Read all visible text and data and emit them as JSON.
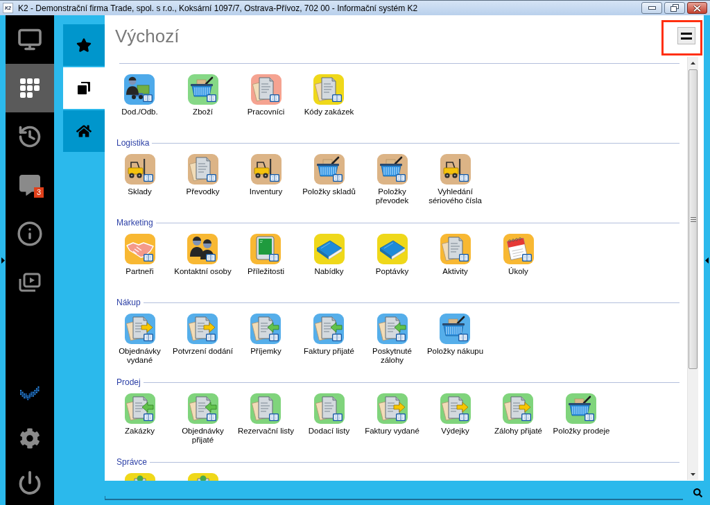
{
  "window": {
    "app_icon_text": "K2",
    "title": "K2 - Demonstrační firma Trade, spol. s r.o., Koksární 1097/7, Ostrava-Přívoz, 702 00 - Informační systém K2"
  },
  "sidebar": {
    "items": [
      {
        "selected": false
      },
      {
        "selected": true
      },
      {
        "selected": false
      },
      {
        "selected": false,
        "badge": "3"
      },
      {
        "selected": false
      },
      {
        "selected": false
      }
    ]
  },
  "tabs": [
    {
      "selected": false
    },
    {
      "selected": true
    },
    {
      "selected": false
    }
  ],
  "page": {
    "title": "Výchozí",
    "menu_highlighted": true
  },
  "sections": [
    {
      "items": [
        {
          "label": "Dod./Odb.",
          "kind": "person-truck",
          "color": "#4eaaea"
        },
        {
          "label": "Zboží",
          "kind": "basket",
          "color": "#86d886"
        },
        {
          "label": "Pracovníci",
          "kind": "document",
          "color": "#f5a391"
        },
        {
          "label": "Kódy zakázek",
          "kind": "document",
          "color": "#efd81a"
        }
      ]
    },
    {
      "title": "Logistika",
      "items": [
        {
          "label": "Sklady",
          "kind": "forklift",
          "color": "#dcb486"
        },
        {
          "label": "Převodky",
          "kind": "document",
          "color": "#dcb486"
        },
        {
          "label": "Inventury",
          "kind": "forklift",
          "color": "#dcb486"
        },
        {
          "label": "Položky skladů",
          "kind": "basket",
          "color": "#dcb486"
        },
        {
          "label": "Položky převodek",
          "kind": "basket",
          "color": "#dcb486"
        },
        {
          "label": "Vyhledání sériového čísla",
          "kind": "forklift",
          "color": "#dcb486"
        }
      ]
    },
    {
      "title": "Marketing",
      "items": [
        {
          "label": "Partneři",
          "kind": "handshake",
          "color": "#f8b833"
        },
        {
          "label": "Kontaktní osoby",
          "kind": "people",
          "color": "#f8b833"
        },
        {
          "label": "Příležitosti",
          "kind": "tablet",
          "color": "#f8b833"
        },
        {
          "label": "Nabídky",
          "kind": "book",
          "color": "#efd81a"
        },
        {
          "label": "Poptávky",
          "kind": "book",
          "color": "#efd81a"
        },
        {
          "label": "Aktivity",
          "kind": "document",
          "color": "#f8b833"
        },
        {
          "label": "Úkoly",
          "kind": "notepad",
          "color": "#f8b833"
        }
      ]
    },
    {
      "title": "Nákup",
      "items": [
        {
          "label": "Objednávky vydané",
          "kind": "document-out",
          "color": "#55aeea"
        },
        {
          "label": "Potvrzení dodání",
          "kind": "document-out",
          "color": "#55aeea"
        },
        {
          "label": "Příjemky",
          "kind": "document-in",
          "color": "#55aeea"
        },
        {
          "label": "Faktury přijaté",
          "kind": "document-in",
          "color": "#55aeea"
        },
        {
          "label": "Poskytnuté zálohy",
          "kind": "document-in",
          "color": "#55aeea"
        },
        {
          "label": "Položky nákupu",
          "kind": "basket",
          "color": "#55aeea"
        }
      ]
    },
    {
      "title": "Prodej",
      "items": [
        {
          "label": "Zakázky",
          "kind": "document-in",
          "color": "#80d47c"
        },
        {
          "label": "Objednávky přijaté",
          "kind": "document-in",
          "color": "#80d47c"
        },
        {
          "label": "Rezervační listy",
          "kind": "document",
          "color": "#80d47c"
        },
        {
          "label": "Dodací listy",
          "kind": "document",
          "color": "#80d47c"
        },
        {
          "label": "Faktury vydané",
          "kind": "document-out",
          "color": "#80d47c"
        },
        {
          "label": "Výdejky",
          "kind": "document-out",
          "color": "#80d47c"
        },
        {
          "label": "Zálohy přijaté",
          "kind": "document-out",
          "color": "#80d47c"
        },
        {
          "label": "Položky prodeje",
          "kind": "basket",
          "color": "#80d47c"
        }
      ]
    },
    {
      "title": "Správce",
      "items": [
        {
          "kind": "admin",
          "color": "#efd81a"
        },
        {
          "kind": "admin",
          "color": "#efd81a"
        }
      ]
    }
  ]
}
